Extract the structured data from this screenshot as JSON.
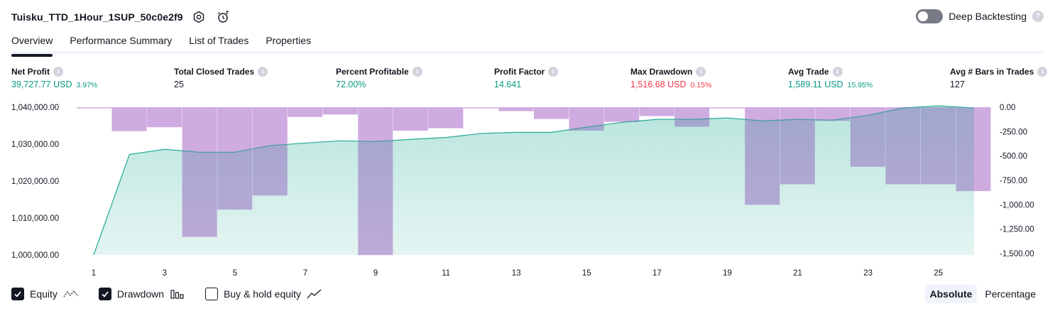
{
  "header": {
    "title": "Tuisku_TTD_1Hour_1SUP_50c0e2f9",
    "icons": [
      "settings-icon",
      "alert-clock-icon"
    ]
  },
  "deep_backtesting": {
    "label": "Deep Backtesting",
    "enabled": false,
    "help": "?"
  },
  "tabs": [
    {
      "label": "Overview",
      "active": true
    },
    {
      "label": "Performance Summary",
      "active": false
    },
    {
      "label": "List of Trades",
      "active": false
    },
    {
      "label": "Properties",
      "active": false
    }
  ],
  "metrics": [
    {
      "label": "Net Profit",
      "value": "39,727.77 USD",
      "pct": "3.97%",
      "color": "#089981"
    },
    {
      "label": "Total Closed Trades",
      "value": "25",
      "pct": "",
      "color": "#131722"
    },
    {
      "label": "Percent Profitable",
      "value": "72.00%",
      "pct": "",
      "color": "#089981"
    },
    {
      "label": "Profit Factor",
      "value": "14.641",
      "pct": "",
      "color": "#089981"
    },
    {
      "label": "Max Drawdown",
      "value": "1,516.68 USD",
      "pct": "0.15%",
      "color": "#f23645"
    },
    {
      "label": "Avg Trade",
      "value": "1,589.11 USD",
      "pct": "15.95%",
      "color": "#089981"
    },
    {
      "label": "Avg # Bars in Trades",
      "value": "127",
      "pct": "",
      "color": "#131722"
    }
  ],
  "info_glyph": "i",
  "chart_data": {
    "type": "area",
    "x": [
      1,
      2,
      3,
      4,
      5,
      6,
      7,
      8,
      9,
      10,
      11,
      12,
      13,
      14,
      15,
      16,
      17,
      18,
      19,
      20,
      21,
      22,
      23,
      24,
      25,
      26
    ],
    "x_tick_labels": [
      "1",
      "3",
      "5",
      "7",
      "9",
      "11",
      "13",
      "15",
      "17",
      "19",
      "21",
      "23",
      "25"
    ],
    "series": [
      {
        "name": "Equity",
        "type": "area",
        "axis": "left",
        "color": "#22ab94",
        "values": [
          1000000,
          1027200,
          1028600,
          1027800,
          1027800,
          1029600,
          1030300,
          1030900,
          1030700,
          1031300,
          1031800,
          1032900,
          1033200,
          1033200,
          1034600,
          1035900,
          1036700,
          1036700,
          1037100,
          1036300,
          1036700,
          1036500,
          1037800,
          1039800,
          1040400,
          1039800
        ]
      },
      {
        "name": "Drawdown",
        "type": "bar",
        "axis": "right",
        "color": "#ce93d8",
        "values": [
          0,
          -245,
          -205,
          -1330,
          -1050,
          -905,
          -100,
          -75,
          -1516.68,
          -240,
          -215,
          0,
          -40,
          -120,
          -240,
          -150,
          -90,
          -200,
          0,
          -1000,
          -790,
          -140,
          -610,
          -790,
          -790,
          -860
        ]
      }
    ],
    "y_left": {
      "ticks": [
        "1,000,000.00",
        "1,010,000.00",
        "1,020,000.00",
        "1,030,000.00",
        "1,040,000.00"
      ],
      "range": [
        1000000,
        1040000
      ]
    },
    "y_right": {
      "ticks": [
        "0.00",
        "-250.00",
        "-500.00",
        "-750.00",
        "-1,000.00",
        "-1,250.00",
        "-1,500.00"
      ],
      "range": [
        -1516.68,
        0
      ]
    },
    "grid": false,
    "title": "",
    "xlabel": "",
    "ylabel": ""
  },
  "legend": [
    {
      "label": "Equity",
      "checked": true,
      "icon": "equity-line-icon"
    },
    {
      "label": "Drawdown",
      "checked": true,
      "icon": "drawdown-bars-icon"
    },
    {
      "label": "Buy & hold equity",
      "checked": false,
      "icon": "buy-hold-line-icon"
    }
  ],
  "scale": {
    "absolute": "Absolute",
    "percentage": "Percentage",
    "selected": "Absolute"
  }
}
